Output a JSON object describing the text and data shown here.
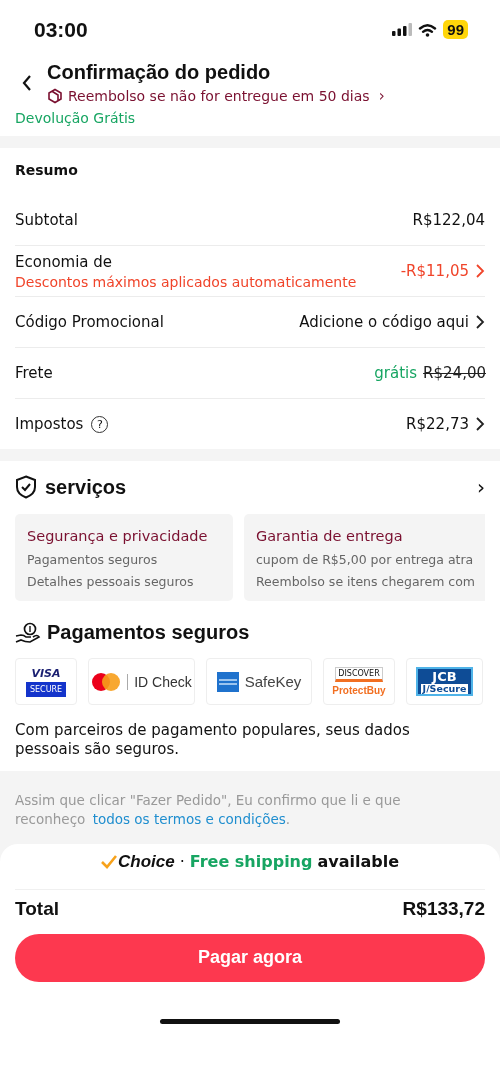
{
  "status_bar": {
    "time": "03:00",
    "battery": "99"
  },
  "header": {
    "title": "Confirmação do pedido",
    "refund_notice": "Reembolso se não for entregue em 50 dias",
    "chevron": "›",
    "free_return": "Devolução Grátis"
  },
  "summary": {
    "title": "Resumo",
    "rows": [
      {
        "kind": "plain",
        "label": "Subtotal",
        "value": "R$122,04"
      },
      {
        "kind": "discount",
        "label": "Economia de",
        "sublabel": "Descontos máximos aplicados automaticamente",
        "value": "-R$11,05",
        "arrow": true
      },
      {
        "kind": "plain",
        "label": "Código Promocional",
        "value": "Adicione o código aqui",
        "arrow": true
      },
      {
        "kind": "shipping",
        "label": "Frete",
        "value": "grátis",
        "old_value": "R$24,00"
      },
      {
        "kind": "help",
        "label": "Impostos",
        "help": "?",
        "value": "R$22,73",
        "arrow": true
      }
    ]
  },
  "services": {
    "title": "serviços",
    "chevron": "›",
    "cards": [
      {
        "title": "Segurança e privacidade",
        "lines": [
          "Pagamentos seguros",
          "Detalhes pessoais seguros"
        ]
      },
      {
        "title": "Garantia de entrega",
        "lines": [
          "cupom de R$5,00 por entrega atra",
          "Reembolso se itens chegarem com"
        ]
      }
    ]
  },
  "payments": {
    "title": "Pagamentos seguros",
    "logos": [
      {
        "kind": "visa",
        "texts": [
          "VISA",
          "SECURE"
        ]
      },
      {
        "kind": "mastercard",
        "texts": [
          "ID Check"
        ]
      },
      {
        "kind": "amex",
        "texts": [
          "SafeKey"
        ]
      },
      {
        "kind": "discover",
        "texts": [
          "DISCOVER",
          "ProtectBuy"
        ]
      },
      {
        "kind": "jcb",
        "texts": [
          "JCB",
          "J/Secure"
        ]
      }
    ],
    "note": "Com parceiros de pagamento populares, seus dados pessoais são seguros."
  },
  "terms": {
    "text": "Assim que clicar \"Fazer Pedido\", Eu confirmo que li e que reconheço ",
    "link": "todos os termos e condições",
    "end": "."
  },
  "footer": {
    "brand": "Choice",
    "separator": "·",
    "free_shipping": "Free shipping",
    "available": "available",
    "total_label": "Total",
    "total_value": "R$133,72",
    "pay_button": "Pagar agora"
  }
}
